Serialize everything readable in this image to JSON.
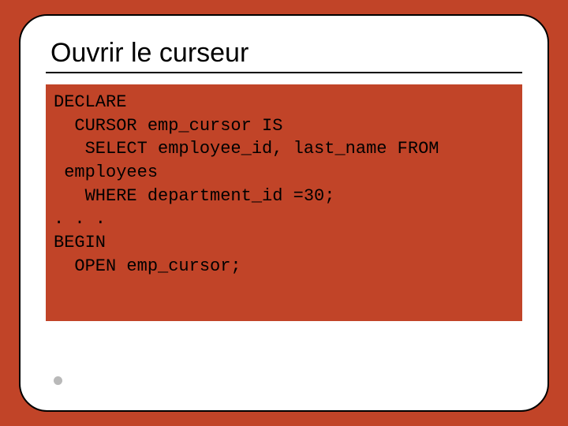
{
  "slide": {
    "title": "Ouvrir le curseur",
    "code": "DECLARE\n  CURSOR emp_cursor IS\n   SELECT employee_id, last_name FROM\n employees\n   WHERE department_id =30;\n. . .\nBEGIN\n  OPEN emp_cursor;"
  }
}
